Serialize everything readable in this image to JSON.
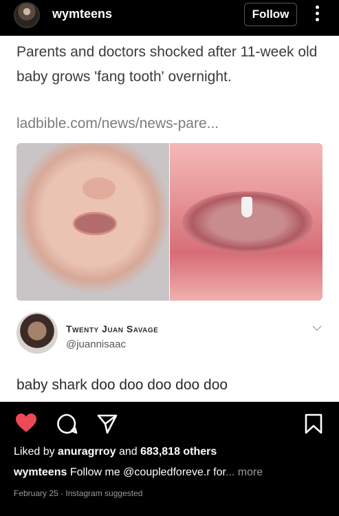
{
  "header": {
    "username": "wymteens",
    "follow_label": "Follow"
  },
  "post": {
    "headline": "Parents and doctors shocked after 11-week old baby grows 'fang tooth' overnight.",
    "link": "ladbible.com/news/news-pare...",
    "reply": {
      "name": "Twenty Juan Savage",
      "handle": "@juannisaac",
      "text": "baby shark doo doo doo doo doo"
    }
  },
  "actions": {
    "like_color": "#ed4956",
    "icons": [
      "heart-icon",
      "comment-icon",
      "share-icon",
      "bookmark-icon"
    ]
  },
  "likes": {
    "prefix": "Liked by",
    "user": "anuragrroy",
    "middle": "and",
    "count": "683,818 others"
  },
  "caption": {
    "username": "wymteens",
    "text": "Follow me @coupledforeve.r for",
    "more": "... more"
  },
  "meta": {
    "date": "February 25 · Instagram suggested"
  }
}
